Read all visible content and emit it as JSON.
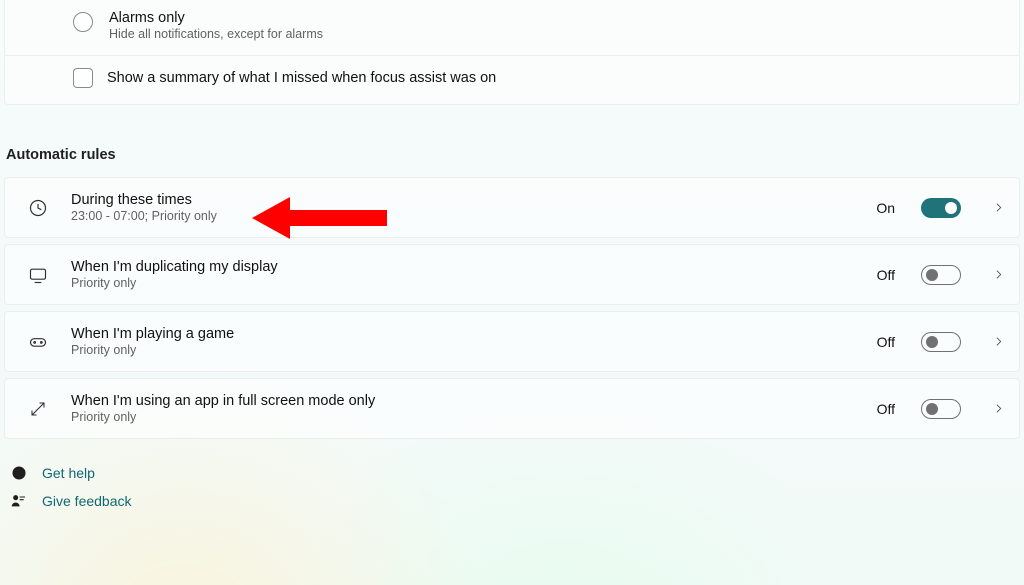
{
  "alarms_option": {
    "title": "Alarms only",
    "sub": "Hide all notifications, except for alarms"
  },
  "summary_checkbox": {
    "label": "Show a summary of what I missed when focus assist was on"
  },
  "section_header": "Automatic rules",
  "rules": [
    {
      "title": "During these times",
      "sub": "23:00 - 07:00; Priority only",
      "state": "On"
    },
    {
      "title": "When I'm duplicating my display",
      "sub": "Priority only",
      "state": "Off"
    },
    {
      "title": "When I'm playing a game",
      "sub": "Priority only",
      "state": "Off"
    },
    {
      "title": "When I'm using an app in full screen mode only",
      "sub": "Priority only",
      "state": "Off"
    }
  ],
  "footer": {
    "help": "Get help",
    "feedback": "Give feedback"
  }
}
